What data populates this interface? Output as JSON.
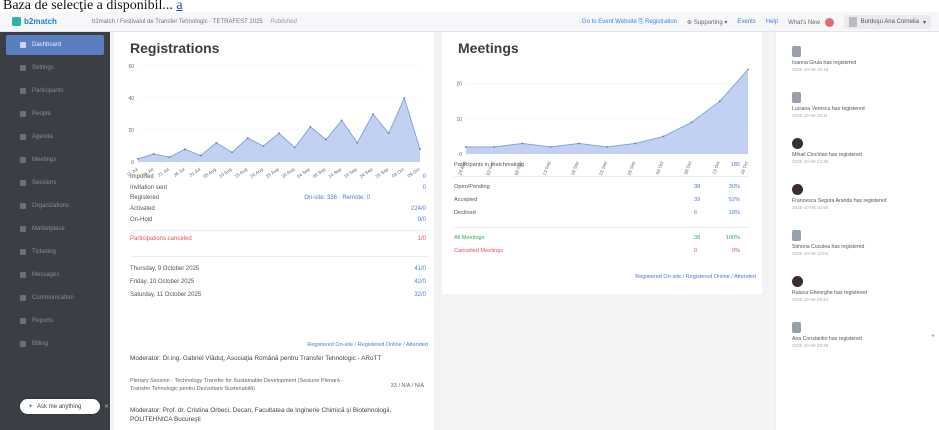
{
  "caption": {
    "text": "Baza de selecţie a disponibil...",
    "link": "a"
  },
  "topbar": {
    "brand": "b2match",
    "breadcrumb": "b2match / Festivalul de Transfer Tehnologic · TETRAFEST 2025",
    "status_chip": "Published",
    "go_to_event": "Go to Event Website",
    "registration": "Registration",
    "supporting": "Supporting",
    "events": "Events",
    "help": "Help",
    "whats_new": "What's New",
    "user": "Burduşu Ana Cornelia"
  },
  "sidebar": {
    "items": [
      "Dashboard",
      "Settings",
      "Participants",
      "People",
      "Agenda",
      "Meetings",
      "Sessions",
      "Organizations",
      "Marketplace",
      "Ticketing",
      "Messages",
      "Communication",
      "Reports",
      "Billing"
    ],
    "active_index": 0,
    "ask_label": "Ask me anything"
  },
  "registrations": {
    "title": "Registrations",
    "y_ticks": [
      "60",
      "40",
      "20",
      "0"
    ],
    "x_ticks": [
      "11 Jul",
      "16 Jul",
      "21 Jul",
      "26 Jul",
      "31 Jul",
      "05 Aug",
      "10 Aug",
      "15 Aug",
      "20 Aug",
      "25 Aug",
      "30 Aug",
      "04 Sep",
      "09 Sep",
      "14 Sep",
      "19 Sep",
      "24 Sep",
      "29 Sep",
      "04 Oct",
      "09 Oct"
    ],
    "stats": [
      {
        "label": "Imported",
        "value": "0"
      },
      {
        "label": "Invitation sent",
        "value": "0"
      },
      {
        "label": "Registered",
        "middle": "On-site: 336 · Remote: 0",
        "value": ""
      },
      {
        "label": "Activated",
        "value": "224/0"
      },
      {
        "label": "On-Hold",
        "value": "0/0"
      }
    ],
    "canceled": {
      "label": "Participations canceled",
      "value": "1/0"
    },
    "days": [
      {
        "label": "Thursday, 9 October 2025",
        "value": "41/0"
      },
      {
        "label": "Friday, 10 October 2025",
        "value": "42/0"
      },
      {
        "label": "Saturday, 11 October 2025",
        "value": "32/0"
      }
    ],
    "legend": "Registered On-site / Registered Online / Attended",
    "moderators": [
      "Moderator: Dr.ing. Gabriel Vlăduţ, Asociaţia Română pentru Transfer Tehnologic - ARoTT",
      "Plenary Session - Technology Transfer for Sustainable Development (Sesiune Plenară - Transfer Tehnologic pentru Dezvoltare Sustenabilă)",
      "Moderator: Prof. dr. Cristina Orbeci, Decan, Facultatea de Inginerie Chimică şi Biotehnologii, POLITEHNICA Bucureşti"
    ],
    "plenary_value": "33 / N/A / N/A"
  },
  "meetings": {
    "title": "Meetings",
    "y_ticks": [
      "20",
      "10",
      "0"
    ],
    "x_ticks": [
      "29 Aug",
      "03 Sep",
      "08 Sep",
      "13 Sep",
      "18 Sep",
      "23 Sep",
      "28 Sep",
      "03 Oct",
      "08 Oct",
      "13 Oct",
      "18 Oct"
    ],
    "total": {
      "label": "Participants in matchmaking",
      "value": "185"
    },
    "rows": [
      {
        "label": "Open/Pending",
        "c1": "38",
        "c2": "30%",
        "style": ""
      },
      {
        "label": "Accepted",
        "c1": "39",
        "c2": "52%",
        "style": ""
      },
      {
        "label": "Declined",
        "c1": "6",
        "c2": "18%",
        "style": ""
      },
      {
        "label": "All Meetings",
        "c1": "38",
        "c2": "100%",
        "style": "green"
      },
      {
        "label": "Cancelled Meetings",
        "c1": "0",
        "c2": "0%",
        "style": "red"
      }
    ],
    "legend": "Registered On-site / Registered Online / Attended"
  },
  "feed": {
    "items": [
      {
        "text": "Ioanna Gruia has registered",
        "time": "2025-10-08 16:18",
        "avatar": "gray"
      },
      {
        "text": "Luciana Verescu has registered",
        "time": "2025-10-08 16:11",
        "avatar": "gray"
      },
      {
        "text": "Mihail Ciocîrlan has registered",
        "time": "2025-10-08 12:35",
        "avatar": "dark"
      },
      {
        "text": "Francesca Segura Aranda has registered",
        "time": "2025-10-08 10:59",
        "avatar": "dark"
      },
      {
        "text": "Simona Cuculea has registered",
        "time": "2025-10-08 10:04",
        "avatar": "gray"
      },
      {
        "text": "Raluca Gheorghe has registered",
        "time": "2025-10-08 09:44",
        "avatar": "dark"
      },
      {
        "text": "Ana Constantin has registered",
        "time": "2025-10-08 08:39",
        "avatar": "gray"
      }
    ]
  },
  "chart_data": [
    {
      "type": "area",
      "title": "Registrations",
      "categories": [
        "11 Jul",
        "16 Jul",
        "21 Jul",
        "26 Jul",
        "31 Jul",
        "05 Aug",
        "10 Aug",
        "15 Aug",
        "20 Aug",
        "25 Aug",
        "30 Aug",
        "04 Sep",
        "09 Sep",
        "14 Sep",
        "19 Sep",
        "24 Sep",
        "29 Sep",
        "04 Oct",
        "09 Oct"
      ],
      "values": [
        2,
        5,
        3,
        8,
        4,
        12,
        6,
        15,
        10,
        18,
        9,
        22,
        14,
        26,
        12,
        30,
        18,
        40,
        8
      ],
      "ylim": [
        0,
        60
      ]
    },
    {
      "type": "area",
      "title": "Meetings",
      "categories": [
        "29 Aug",
        "03 Sep",
        "08 Sep",
        "13 Sep",
        "18 Sep",
        "23 Sep",
        "28 Sep",
        "03 Oct",
        "08 Oct",
        "13 Oct",
        "18 Oct"
      ],
      "values": [
        2,
        2,
        3,
        2,
        3,
        2,
        3,
        5,
        9,
        15,
        24
      ],
      "ylim": [
        0,
        25
      ]
    }
  ]
}
